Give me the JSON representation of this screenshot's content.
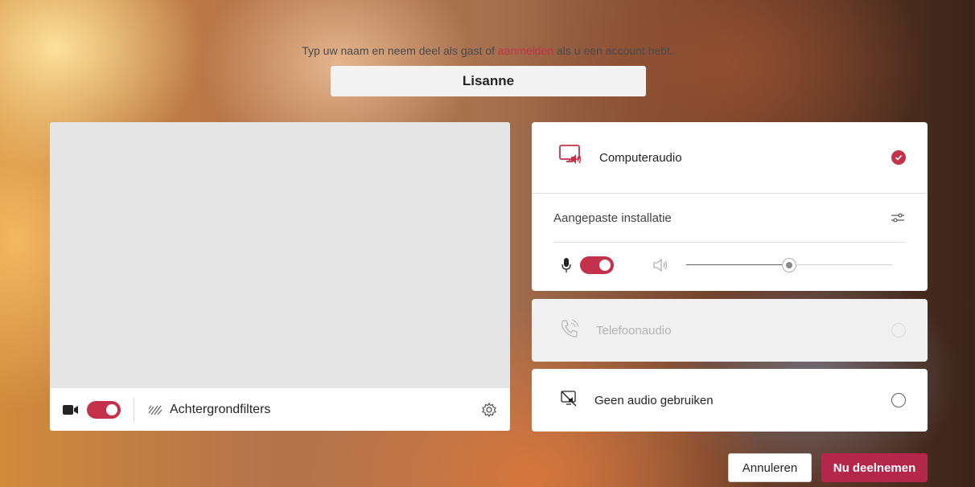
{
  "prompt": {
    "before": "Typ uw naam en neem deel als gast of ",
    "link": "aanmelden",
    "after": " als u een account hebt."
  },
  "name_field": {
    "value": "Lisanne"
  },
  "video": {
    "camera_on": true,
    "filters_label": "Achtergrondfilters"
  },
  "audio_options": {
    "computer": {
      "label": "Computeraudio",
      "selected": true,
      "custom_setup_label": "Aangepaste installatie",
      "mic_on": true,
      "volume": 0.5
    },
    "phone": {
      "label": "Telefoonaudio",
      "disabled": true
    },
    "none": {
      "label": "Geen audio gebruiken",
      "selected": false
    }
  },
  "buttons": {
    "cancel": "Annuleren",
    "join": "Nu deelnemen"
  },
  "colors": {
    "accent": "#c4314b",
    "join": "#b5274a"
  }
}
